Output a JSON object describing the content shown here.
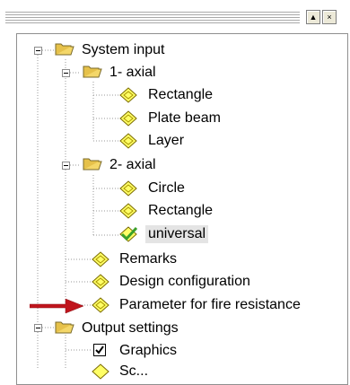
{
  "toolbar": {
    "up_arrow": "▲",
    "close_glyph": "×"
  },
  "tree": {
    "system_input": "System input",
    "axial1": "1- axial",
    "rectangle1": "Rectangle",
    "plate_beam": "Plate beam",
    "layer": "Layer",
    "axial2": "2- axial",
    "circle": "Circle",
    "rectangle2": "Rectangle",
    "universal": "universal",
    "remarks": "Remarks",
    "design_configuration": "Design  configuration",
    "fire_resistance": "Parameter for fire resistance",
    "output_settings": "Output settings",
    "graphics": "Graphics",
    "partial_next": "Sc..."
  },
  "colors": {
    "folder": "#f4d769",
    "diamond": "#ffff66",
    "arrow": "#c0151d",
    "selection": "#e4e4e4",
    "check_green": "#3aa02a"
  },
  "icons": {
    "folder": "folder-icon",
    "diamond": "diamond-icon",
    "checked_diamond": "checked-diamond-icon"
  }
}
